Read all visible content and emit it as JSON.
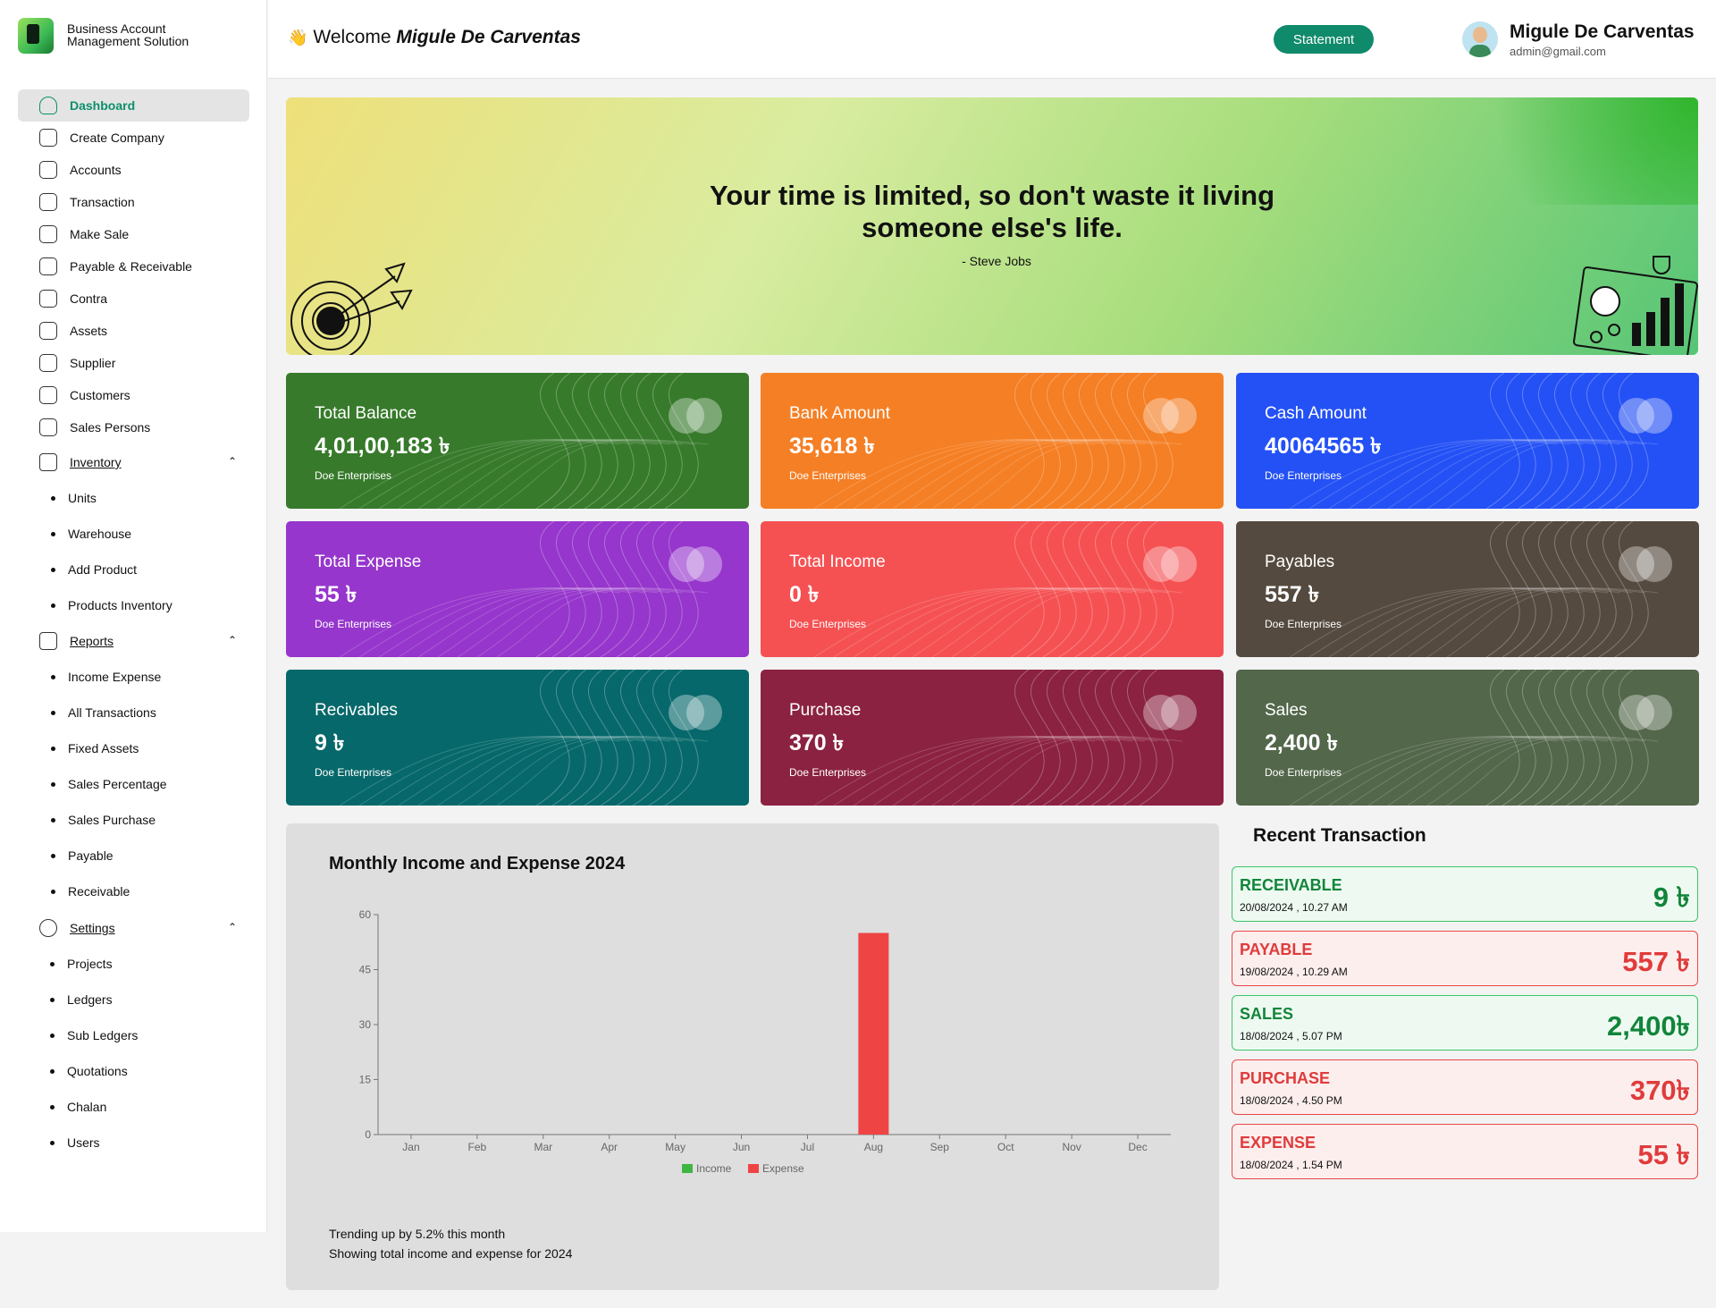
{
  "brand": {
    "line1": "Business Account",
    "line2": "Management Solution"
  },
  "sidebar": {
    "items": [
      {
        "label": "Dashboard",
        "icon": "home-icon"
      },
      {
        "label": "Create Company",
        "icon": "building-icon"
      },
      {
        "label": "Accounts",
        "icon": "dollar-icon"
      },
      {
        "label": "Transaction",
        "icon": "exchange-icon"
      },
      {
        "label": "Make Sale",
        "icon": "exchange-icon"
      },
      {
        "label": "Payable & Receivable",
        "icon": "receipt-icon"
      },
      {
        "label": "Contra",
        "icon": "dollar-icon"
      },
      {
        "label": "Assets",
        "icon": "box-icon"
      },
      {
        "label": "Supplier",
        "icon": "id-card-icon"
      },
      {
        "label": "Customers",
        "icon": "id-card-icon"
      },
      {
        "label": "Sales Persons",
        "icon": "user-badge-icon"
      }
    ],
    "inventory": {
      "label": "Inventory",
      "items": [
        "Units",
        "Warehouse",
        "Add Product",
        "Products Inventory"
      ]
    },
    "reports": {
      "label": "Reports",
      "items": [
        "Income Expense",
        "All Transactions",
        "Fixed Assets",
        "Sales Percentage",
        "Sales Purchase",
        "Payable",
        "Receivable"
      ]
    },
    "settings": {
      "label": "Settings",
      "items": [
        "Projects",
        "Ledgers",
        "Sub Ledgers",
        "Quotations",
        "Chalan",
        "Users"
      ]
    }
  },
  "header": {
    "welcome": "Welcome",
    "wave": "👋",
    "user_name": "Migule De Carventas",
    "statement": "Statement",
    "profile_name": "Migule De Carventas",
    "profile_email": "admin@gmail.com"
  },
  "hero": {
    "quote_line1": "Your time is limited, so don't waste it living",
    "quote_line2": "someone else's life.",
    "author": "- Steve Jobs"
  },
  "cards": [
    {
      "title": "Total Balance",
      "value": "4,01,00,183 ৳",
      "sub": "Doe Enterprises",
      "color": "#377a2b"
    },
    {
      "title": "Bank Amount",
      "value": "35,618 ৳",
      "sub": "Doe Enterprises",
      "color": "#f57f24"
    },
    {
      "title": "Cash Amount",
      "value": "40064565 ৳",
      "sub": "Doe Enterprises",
      "color": "#2451f5"
    },
    {
      "title": "Total Expense",
      "value": "55 ৳",
      "sub": "Doe Enterprises",
      "color": "#9636cc"
    },
    {
      "title": "Total Income",
      "value": "0 ৳",
      "sub": "Doe Enterprises",
      "color": "#f55153"
    },
    {
      "title": "Payables",
      "value": "557 ৳",
      "sub": "Doe Enterprises",
      "color": "#554a3f"
    },
    {
      "title": "Recivables",
      "value": "9 ৳",
      "sub": "Doe Enterprises",
      "color": "#06686a"
    },
    {
      "title": "Purchase",
      "value": "370 ৳",
      "sub": "Doe Enterprises",
      "color": "#8b2241"
    },
    {
      "title": "Sales",
      "value": "2,400 ৳",
      "sub": "Doe Enterprises",
      "color": "#53674b"
    }
  ],
  "chart_title": "Monthly Income and Expense 2024",
  "chart_data": {
    "type": "bar",
    "categories": [
      "Jan",
      "Feb",
      "Mar",
      "Apr",
      "May",
      "Jun",
      "Jul",
      "Aug",
      "Sep",
      "Oct",
      "Nov",
      "Dec"
    ],
    "series": [
      {
        "name": "Income",
        "values": [
          0,
          0,
          0,
          0,
          0,
          0,
          0,
          0,
          0,
          0,
          0,
          0
        ],
        "color": "#3fb542"
      },
      {
        "name": "Expense",
        "values": [
          0,
          0,
          0,
          0,
          0,
          0,
          0,
          55,
          0,
          0,
          0,
          0
        ],
        "color": "#ef4444"
      }
    ],
    "yticks": [
      0,
      15,
      30,
      45,
      60
    ],
    "ylim": [
      0,
      60
    ],
    "legend": "bottom"
  },
  "trend": {
    "line1": "Trending up by 5.2% this month",
    "line2": "Showing total income and expense for 2024"
  },
  "recent": {
    "title": "Recent Transaction",
    "items": [
      {
        "type": "RECEIVABLE",
        "date": "20/08/2024 , 10.27 AM",
        "amount": "9 ৳",
        "tone": "g"
      },
      {
        "type": "PAYABLE",
        "date": "19/08/2024 , 10.29 AM",
        "amount": "557 ৳",
        "tone": "r"
      },
      {
        "type": "SALES",
        "date": "18/08/2024 , 5.07 PM",
        "amount": "2,400৳",
        "tone": "g"
      },
      {
        "type": "PURCHASE",
        "date": "18/08/2024 , 4.50 PM",
        "amount": "370৳",
        "tone": "r"
      },
      {
        "type": "EXPENSE",
        "date": "18/08/2024 , 1.54 PM",
        "amount": "55 ৳",
        "tone": "r"
      }
    ]
  }
}
